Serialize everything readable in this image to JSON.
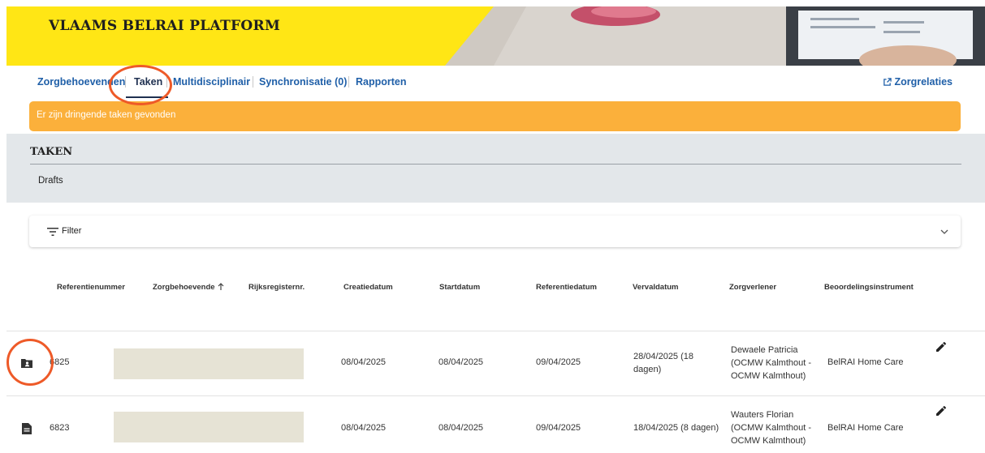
{
  "app": {
    "brand": "VLAAMS BELRAI PLATFORM"
  },
  "nav": {
    "items": [
      {
        "label": "Zorgbehoevenden",
        "active": false
      },
      {
        "label": "Taken",
        "active": true
      },
      {
        "label": "Multidisciplinair",
        "active": false
      },
      {
        "label": "Synchronisatie (0)",
        "active": false
      },
      {
        "label": "Rapporten",
        "active": false
      }
    ],
    "zorgrelaties_label": "Zorgrelaties",
    "zorgrelaties_icon": "external-link-icon"
  },
  "alert": {
    "text": "Er zijn dringende taken gevonden",
    "color": "#fbb03b"
  },
  "tabs_panel": {
    "title": "TAKEN",
    "subtab": "Drafts"
  },
  "filter": {
    "label": "Filter",
    "icon": "filter-icon",
    "expand_icon": "chevron-down-icon"
  },
  "table": {
    "columns": [
      "Referentienummer",
      "Zorgbehoevende",
      "Rijksregisternr.",
      "Creatiedatum",
      "Startdatum",
      "Referentiedatum",
      "Vervaldatum",
      "Zorgverlener",
      "Beoordelingsinstrument"
    ],
    "sorted_column": "Zorgbehoevende",
    "sort_icon": "arrow-up-icon",
    "rows": [
      {
        "row_icon": "folder-person-icon",
        "referentienummer": "6825",
        "creatiedatum": "08/04/2025",
        "startdatum": "08/04/2025",
        "referentiedatum": "09/04/2025",
        "vervaldatum_line1": "28/04/2025 (18",
        "vervaldatum_line2": "dagen)",
        "zorgverlener_line1": "Dewaele Patricia",
        "zorgverlener_line2": "(OCMW Kalmthout -",
        "zorgverlener_line3": "OCMW Kalmthout)",
        "beoordelingsinstrument": "BelRAI Home Care",
        "action_icon": "pencil-icon"
      },
      {
        "row_icon": "document-icon",
        "referentienummer": "6823",
        "creatiedatum": "08/04/2025",
        "startdatum": "08/04/2025",
        "referentiedatum": "09/04/2025",
        "vervaldatum_line1": "18/04/2025 (8 dagen)",
        "vervaldatum_line2": "",
        "zorgverlener_line1": "Wauters Florian",
        "zorgverlener_line2": "(OCMW Kalmthout -",
        "zorgverlener_line3": "OCMW Kalmthout)",
        "beoordelingsinstrument": "BelRAI Home Care",
        "action_icon": "pencil-icon"
      }
    ]
  },
  "colors": {
    "banner_yellow": "#ffe615",
    "nav_link": "#1f5fa8",
    "annotation": "#ee5a28"
  }
}
